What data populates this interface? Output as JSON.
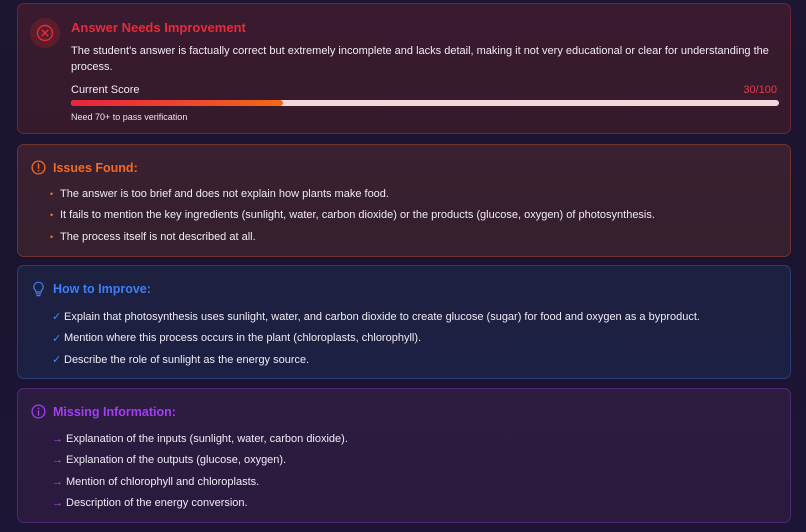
{
  "colors": {
    "error": "#e62c3c",
    "issues": "#f36a22",
    "improve": "#3d7ef5",
    "missing": "#a23ff0"
  },
  "score_card": {
    "icon": "close-circle-icon",
    "title": "Answer Needs Improvement",
    "description": "The student's answer is factually correct but extremely incomplete and lacks detail, making it not very educational or clear for understanding the process.",
    "score_label": "Current Score",
    "score_value": "30/100",
    "score_fraction": 0.3,
    "note": "Need 70+ to pass verification"
  },
  "issues": {
    "icon": "alert-circle-icon",
    "title": "Issues Found:",
    "marker": "•",
    "items": [
      "The answer is too brief and does not explain how plants make food.",
      "It fails to mention the key ingredients (sunlight, water, carbon dioxide) or the products (glucose, oxygen) of photosynthesis.",
      "The process itself is not described at all."
    ]
  },
  "improve": {
    "icon": "lightbulb-icon",
    "title": "How to Improve:",
    "marker": "✓",
    "items": [
      "Explain that photosynthesis uses sunlight, water, and carbon dioxide to create glucose (sugar) for food and oxygen as a byproduct.",
      "Mention where this process occurs in the plant (chloroplasts, chlorophyll).",
      "Describe the role of sunlight as the energy source."
    ]
  },
  "missing": {
    "icon": "info-circle-icon",
    "title": "Missing Information:",
    "marker": "→",
    "items": [
      "Explanation of the inputs (sunlight, water, carbon dioxide).",
      "Explanation of the outputs (glucose, oxygen).",
      "Mention of chlorophyll and chloroplasts.",
      "Description of the energy conversion."
    ]
  }
}
